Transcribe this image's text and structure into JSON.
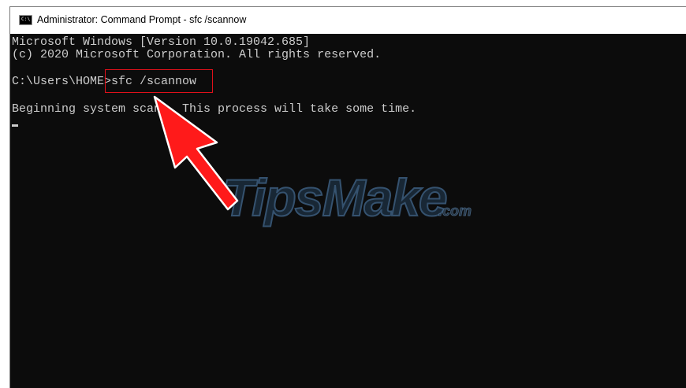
{
  "window": {
    "title": "Administrator: Command Prompt - sfc  /scannow",
    "icon_label": "C:\\"
  },
  "console": {
    "line1": "Microsoft Windows [Version 10.0.19042.685]",
    "line2": "(c) 2020 Microsoft Corporation. All rights reserved.",
    "prompt": "C:\\Users\\HOME>",
    "command": "sfc /scannow",
    "output": "Beginning system scan.  This process will take some time."
  },
  "watermark": {
    "brand": "TipsMake",
    "suffix": ".com"
  },
  "colors": {
    "console_bg": "#0c0c0c",
    "console_text": "#cccccc",
    "highlight": "#e0101a",
    "arrow": "#ff1a1a"
  }
}
